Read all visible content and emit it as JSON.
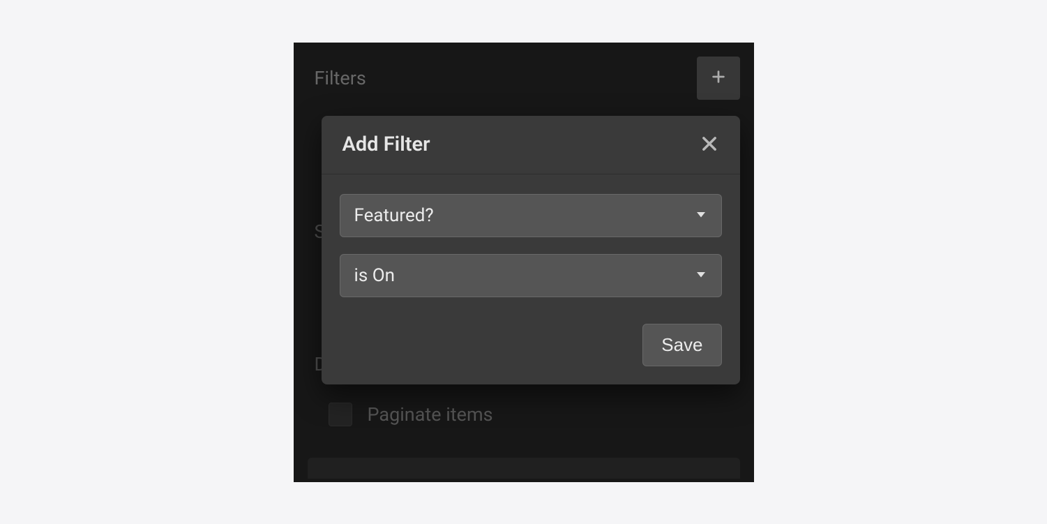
{
  "filters_section_label": "Filters",
  "background": {
    "s_label": "S",
    "d_label": "D",
    "paginate_label": "Paginate items"
  },
  "modal": {
    "title": "Add Filter",
    "field_select": {
      "selected": "Featured?"
    },
    "condition_select": {
      "selected": "is On"
    },
    "save_label": "Save"
  }
}
